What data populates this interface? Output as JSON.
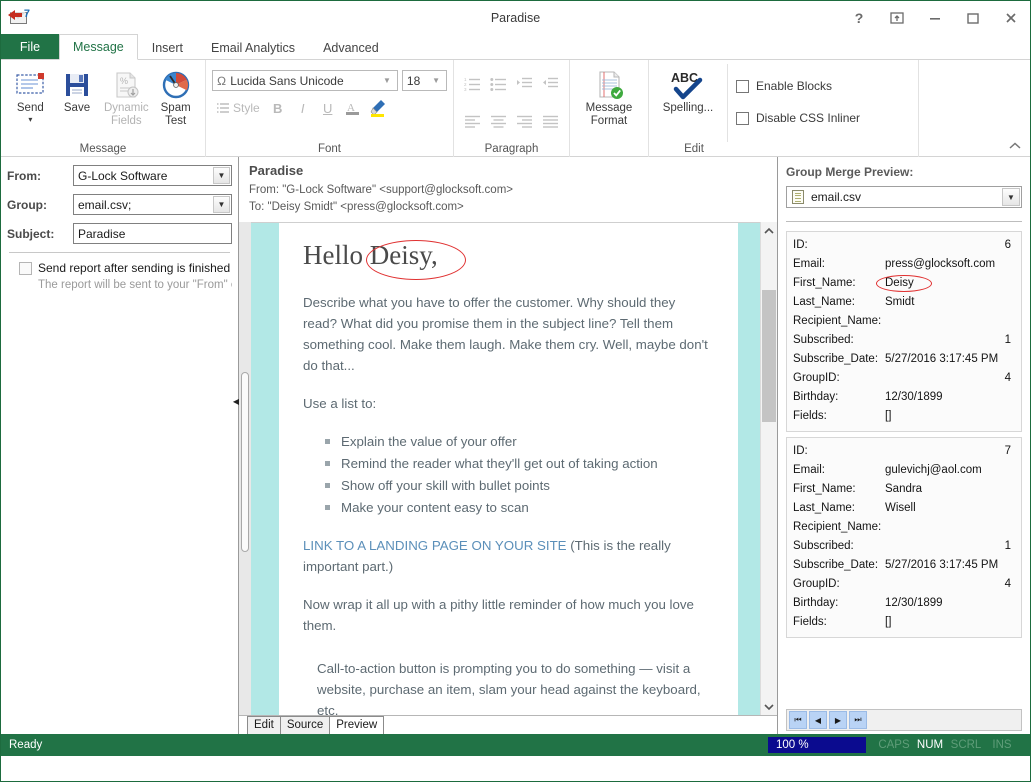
{
  "window": {
    "title": "Paradise",
    "app_icon": "mail-app-icon",
    "controls": [
      {
        "name": "help-button",
        "glyph": "?"
      },
      {
        "name": "restore-ribbon-button",
        "glyph": "box-arrow"
      },
      {
        "name": "minimize-button",
        "glyph": "minimize"
      },
      {
        "name": "maximize-button",
        "glyph": "maximize"
      },
      {
        "name": "close-button",
        "glyph": "close"
      }
    ]
  },
  "ribbon": {
    "file_tab": "File",
    "tabs": [
      {
        "label": "Message",
        "active": true
      },
      {
        "label": "Insert",
        "active": false
      },
      {
        "label": "Email Analytics",
        "active": false
      },
      {
        "label": "Advanced",
        "active": false
      }
    ],
    "collapse_label": "collapse-ribbon",
    "groups": {
      "message": {
        "label": "Message",
        "buttons": [
          {
            "name": "send-button",
            "label": "Send",
            "icon": "envelope-icon",
            "has_caret": true,
            "disabled": false
          },
          {
            "name": "save-button",
            "label": "Save",
            "icon": "floppy-disk-icon",
            "has_caret": false,
            "disabled": false
          },
          {
            "name": "dynamic-fields-button",
            "label": "Dynamic Fields",
            "icon": "percent-document-icon",
            "has_caret": true,
            "disabled": true
          },
          {
            "name": "spam-test-button",
            "label": "Spam Test",
            "icon": "gauge-icon",
            "has_caret": false,
            "disabled": false
          }
        ]
      },
      "font": {
        "label": "Font",
        "font_name": "Lucida Sans Unicode",
        "font_size": "18",
        "style_label": "Style",
        "buttons": [
          {
            "name": "bold-button",
            "label": "B"
          },
          {
            "name": "italic-button",
            "label": "I"
          },
          {
            "name": "underline-button",
            "label": "U"
          },
          {
            "name": "font-color-button",
            "label": "A"
          },
          {
            "name": "highlight-button",
            "label": "pen"
          }
        ]
      },
      "paragraph": {
        "label": "Paragraph",
        "row1": [
          "numbered-list-icon",
          "bulleted-list-icon",
          "increase-indent-icon",
          "decrease-indent-icon"
        ],
        "row2": [
          "align-left-icon",
          "align-center-icon",
          "align-right-icon",
          "align-justify-icon"
        ]
      },
      "format": {
        "message_format_label": "Message Format",
        "spelling_label": "Spelling...",
        "spelling_icon_text": "ABC"
      },
      "edit": {
        "label": "Edit",
        "checkboxes": [
          {
            "name": "enable-blocks-checkbox",
            "label": "Enable Blocks",
            "checked": false
          },
          {
            "name": "disable-css-inliner-checkbox",
            "label": "Disable CSS Inliner",
            "checked": false
          }
        ]
      }
    }
  },
  "left_pane": {
    "fields": [
      {
        "name": "from-field",
        "label": "From:",
        "value": "G-Lock Software",
        "type": "dropdown"
      },
      {
        "name": "group-field",
        "label": "Group:",
        "value": "email.csv;",
        "type": "dropdown"
      },
      {
        "name": "subject-field",
        "label": "Subject:",
        "value": "Paradise",
        "type": "text"
      }
    ],
    "report_checkbox": {
      "label": "Send report after sending is finished",
      "checked": false,
      "hint": "The report will be sent to your \"From\" email  ."
    }
  },
  "mail_header": {
    "subject": "Paradise",
    "from": "From: \"G-Lock Software\" <support@glocksoft.com>",
    "to": "To: \"Deisy Smidt\" <press@glocksoft.com>"
  },
  "mail_body": {
    "greeting_prefix": "Hello",
    "greeting_name": "Deisy,",
    "paragraph1": "Describe what you have to offer the customer. Why should they read? What did you promise them in the subject line? Tell them something cool. Make them laugh. Make them cry. Well, maybe don't do that...",
    "list_intro": "Use a list to:",
    "list_items": [
      "Explain the value of your offer",
      "Remind the reader what they'll get out of taking action",
      "Show off your skill with bullet points",
      "Make your content easy to scan"
    ],
    "link_text": "LINK TO A LANDING PAGE ON YOUR SITE",
    "link_tail": " (This is the really important part.)",
    "paragraph2": "Now wrap it all up with a pithy little reminder of how much you love them.",
    "paragraph3": "Call-to-action button is prompting you to do something — visit a website, purchase an item, slam your head against the keyboard, etc."
  },
  "editor_tabs": [
    {
      "label": "Edit",
      "active": false
    },
    {
      "label": "Source",
      "active": false
    },
    {
      "label": "Preview",
      "active": true
    }
  ],
  "right_pane": {
    "title": "Group Merge Preview:",
    "source_file": "email.csv",
    "records": [
      {
        "ID": "6",
        "Email": "press@glocksoft.com",
        "First_Name": "Deisy",
        "Last_Name": "Smidt",
        "Recipient_Name": "",
        "Subscribed": "1",
        "Subscribe_Date": "5/27/2016 3:17:45 PM",
        "GroupID": "4",
        "Birthday": "12/30/1899",
        "Fields": "[]",
        "highlight_first_name": true
      },
      {
        "ID": "7",
        "Email": "gulevichj@aol.com",
        "First_Name": "Sandra",
        "Last_Name": "Wisell",
        "Recipient_Name": "",
        "Subscribed": "1",
        "Subscribe_Date": "5/27/2016 3:17:45 PM",
        "GroupID": "4",
        "Birthday": "12/30/1899",
        "Fields": "[]",
        "highlight_first_name": false
      }
    ],
    "field_labels": {
      "id": "ID:",
      "email": "Email:",
      "first_name": "First_Name:",
      "last_name": "Last_Name:",
      "recipient_name": "Recipient_Name:",
      "subscribed": "Subscribed:",
      "subscribe_date": "Subscribe_Date:",
      "group_id": "GroupID:",
      "birthday": "Birthday:",
      "fields": "Fields:"
    },
    "nav_buttons": [
      {
        "name": "first-record-button",
        "glyph": "⏮"
      },
      {
        "name": "previous-record-button",
        "glyph": "◀"
      },
      {
        "name": "next-record-button",
        "glyph": "▶"
      },
      {
        "name": "last-record-button",
        "glyph": "⏭"
      }
    ]
  },
  "status_bar": {
    "ready": "Ready",
    "zoom": "100 %",
    "indicators": [
      {
        "label": "CAPS",
        "on": false
      },
      {
        "label": "NUM",
        "on": true
      },
      {
        "label": "SCRL",
        "on": false
      },
      {
        "label": "INS",
        "on": false
      }
    ]
  },
  "colors": {
    "accent_green": "#217346",
    "cyan_bar": "#b2e8e6",
    "annotation_red": "#e03131",
    "link_blue": "#5b8fb9",
    "zoom_blue": "#0b0b8f"
  }
}
